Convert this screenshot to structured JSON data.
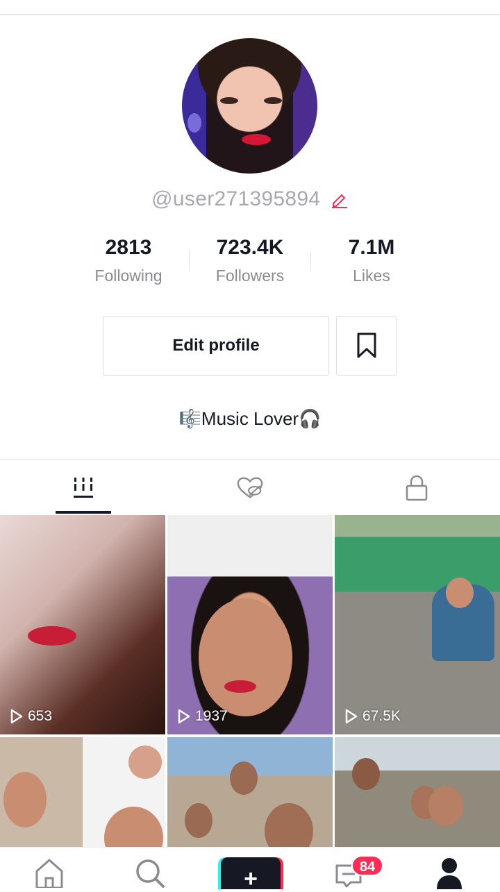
{
  "profile": {
    "username": "@user271395894",
    "bio": "🎼Music Lover🎧"
  },
  "stats": {
    "following": {
      "value": "2813",
      "label": "Following"
    },
    "followers": {
      "value": "723.4K",
      "label": "Followers"
    },
    "likes": {
      "value": "7.1M",
      "label": "Likes"
    }
  },
  "actions": {
    "edit_profile": "Edit profile"
  },
  "tabs": [
    "videos-grid-icon",
    "liked-hidden-icon",
    "private-lock-icon"
  ],
  "videos": [
    {
      "views": "653"
    },
    {
      "views": "1937"
    },
    {
      "views": "67.5K"
    },
    {
      "views": ""
    },
    {
      "views": ""
    },
    {
      "views": ""
    }
  ],
  "bottom_nav": {
    "inbox_badge": "84",
    "icons": [
      "home-icon",
      "search-icon",
      "create-icon",
      "inbox-icon",
      "profile-icon"
    ]
  },
  "colors": {
    "accent_red": "#fe2c55",
    "accent_cyan": "#25f4ee",
    "text_dark": "#161823",
    "text_muted": "#8a8b91"
  }
}
